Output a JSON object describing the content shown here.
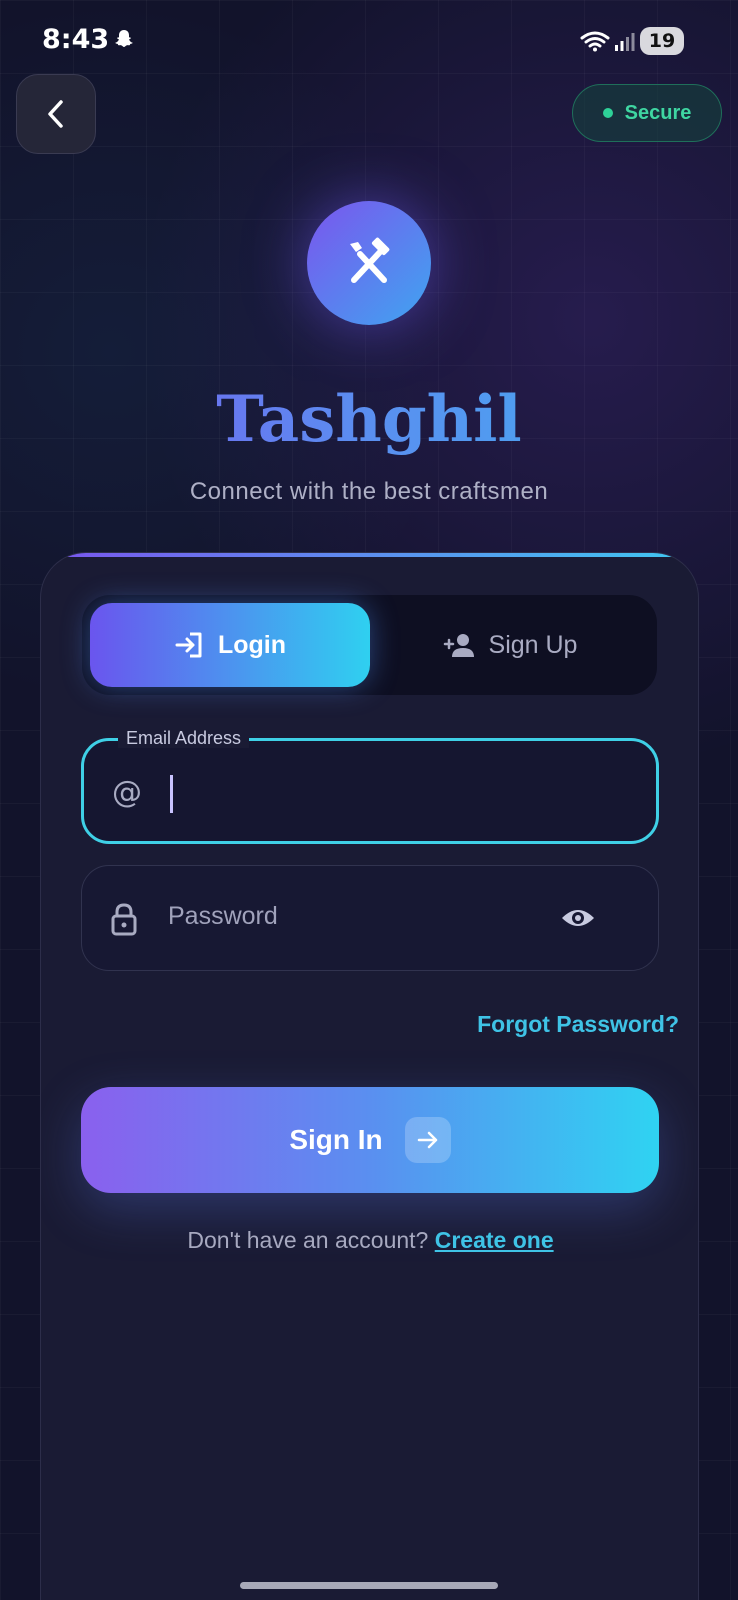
{
  "status_bar": {
    "time": "8:43",
    "battery": "19"
  },
  "header": {
    "secure_label": "Secure"
  },
  "brand": {
    "title": "Tashghil",
    "subtitle": "Connect with the best craftsmen"
  },
  "tabs": [
    {
      "label": "Login",
      "icon": "login-icon",
      "active": true
    },
    {
      "label": "Sign Up",
      "icon": "add-user-icon",
      "active": false
    }
  ],
  "form": {
    "email_label": "Email Address",
    "email_value": "",
    "password_placeholder": "Password",
    "forgot_label": "Forgot Password?",
    "submit_label": "Sign In"
  },
  "footer": {
    "prompt": "Don't have an account? ",
    "link": "Create one"
  },
  "colors": {
    "background": "#12132b",
    "accent_purple": "#7a55ee",
    "accent_cyan": "#2fd0f0",
    "secure_green": "#3fd6a2",
    "link": "#3fc3e6"
  }
}
